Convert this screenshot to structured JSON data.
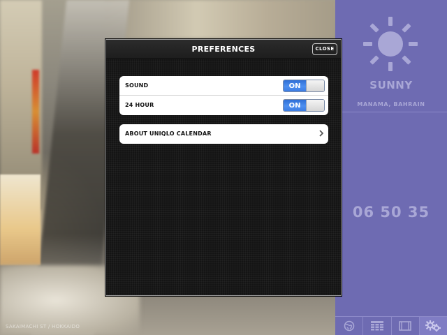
{
  "background": {
    "credit": "SAKAIMACHI ST / HOKKAIDO"
  },
  "dialog": {
    "title": "PREFERENCES",
    "close_label": "CLOSE",
    "settings": [
      {
        "label": "SOUND",
        "toggle": "ON"
      },
      {
        "label": "24 HOUR",
        "toggle": "ON"
      }
    ],
    "about_label": "ABOUT UNIQLO CALENDAR"
  },
  "weather": {
    "icon": "sun-icon",
    "condition": "SUNNY",
    "location": "MANAMA, BAHRAIN",
    "time": "06 50 35"
  },
  "tabs": [
    {
      "icon": "globe-icon",
      "active": false
    },
    {
      "icon": "calendar-grid-icon",
      "active": false
    },
    {
      "icon": "film-icon",
      "active": false
    },
    {
      "icon": "gears-icon",
      "active": true
    }
  ],
  "colors": {
    "panel": "#6e6bb2",
    "panel_text": "#a9a7d6",
    "toggle_on": "#3d7ce2",
    "dialog_bg": "#141414"
  }
}
